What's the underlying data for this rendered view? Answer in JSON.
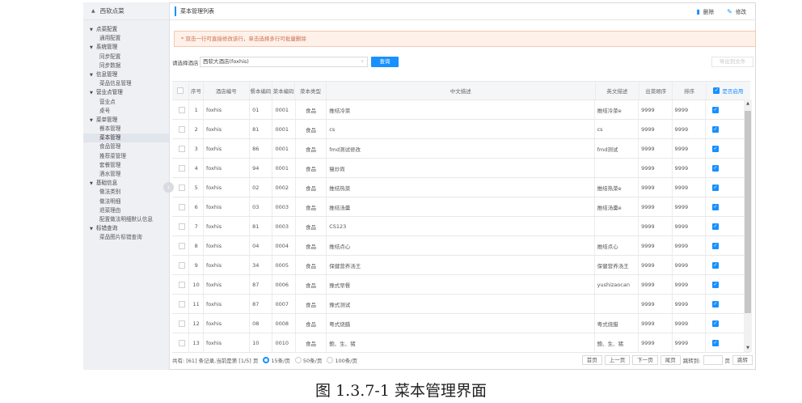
{
  "sidebar": {
    "title": "西软点菜",
    "items": [
      {
        "label": "点菜配置",
        "type": "section"
      },
      {
        "label": "通用配置",
        "type": "item"
      },
      {
        "label": "系统管理",
        "type": "section"
      },
      {
        "label": "同步配置",
        "type": "item"
      },
      {
        "label": "同步数据",
        "type": "item"
      },
      {
        "label": "信息管理",
        "type": "section"
      },
      {
        "label": "菜品信息管理",
        "type": "item"
      },
      {
        "label": "营业点管理",
        "type": "section"
      },
      {
        "label": "营业点",
        "type": "item"
      },
      {
        "label": "桌号",
        "type": "item"
      },
      {
        "label": "菜单管理",
        "type": "section"
      },
      {
        "label": "餐本管理",
        "type": "item"
      },
      {
        "label": "菜本管理",
        "type": "item",
        "active": true
      },
      {
        "label": "食品管理",
        "type": "item"
      },
      {
        "label": "推荐菜管理",
        "type": "item"
      },
      {
        "label": "套餐管理",
        "type": "item"
      },
      {
        "label": "酒水管理",
        "type": "item"
      },
      {
        "label": "基础信息",
        "type": "section"
      },
      {
        "label": "做法类别",
        "type": "item"
      },
      {
        "label": "做法明细",
        "type": "item"
      },
      {
        "label": "退菜理由",
        "type": "item"
      },
      {
        "label": "配置做法明细默认信息",
        "type": "item"
      },
      {
        "label": "标错查询",
        "type": "section"
      },
      {
        "label": "菜品图片标错查询",
        "type": "item"
      }
    ]
  },
  "topbar": {
    "title": "菜本管理列表",
    "delete_label": "删除",
    "edit_label": "修改"
  },
  "hint": "* 双击一行可直接修改该行，单击选择多行可批量删除",
  "filter": {
    "label": "请选择酒店",
    "selected": "西软大酒店(foxhis)",
    "query_label": "查询",
    "export_label": "导出到文件"
  },
  "table": {
    "columns": [
      "序号",
      "酒店编号",
      "餐本编码",
      "菜本编码",
      "菜本类型",
      "中文描述",
      "英文描述",
      "出菜顺序",
      "排序",
      "是否启用"
    ],
    "rows": [
      [
        "1",
        "foxhis",
        "01",
        "0001",
        "食品",
        "推结冷菜",
        "推结冷菜e",
        "9999",
        "9999"
      ],
      [
        "2",
        "foxhis",
        "81",
        "0001",
        "食品",
        "cs",
        "cs",
        "9999",
        "9999"
      ],
      [
        "3",
        "foxhis",
        "86",
        "0001",
        "食品",
        "fmd测试修改",
        "fmd测试",
        "9999",
        "9999"
      ],
      [
        "4",
        "foxhis",
        "94",
        "0001",
        "食品",
        "瘦炒尚",
        "",
        "9999",
        "9999"
      ],
      [
        "5",
        "foxhis",
        "02",
        "0002",
        "食品",
        "推结热菜",
        "推结热菜e",
        "9999",
        "9999"
      ],
      [
        "6",
        "foxhis",
        "03",
        "0003",
        "食品",
        "推结汤羹",
        "推结汤羹e",
        "9999",
        "9999"
      ],
      [
        "7",
        "foxhis",
        "81",
        "0003",
        "食品",
        "CS123",
        "",
        "9999",
        "9999"
      ],
      [
        "8",
        "foxhis",
        "04",
        "0004",
        "食品",
        "推结点心",
        "推结点心",
        "9999",
        "9999"
      ],
      [
        "9",
        "foxhis",
        "34",
        "0005",
        "食品",
        "保健营养汤王",
        "保健营养汤王",
        "9999",
        "9999"
      ],
      [
        "10",
        "foxhis",
        "87",
        "0006",
        "食品",
        "豫式早餐",
        "yushizaocan",
        "9999",
        "9999"
      ],
      [
        "11",
        "foxhis",
        "87",
        "0007",
        "食品",
        "豫式测试",
        "",
        "9999",
        "9999"
      ],
      [
        "12",
        "foxhis",
        "08",
        "0008",
        "食品",
        "粤式烧腊",
        "粤式烧腊",
        "9999",
        "9999"
      ],
      [
        "13",
        "foxhis",
        "10",
        "0010",
        "食品",
        "鲍、生、猪",
        "鲍、生、猪",
        "9999",
        "9999"
      ]
    ]
  },
  "footer": {
    "summary": "共有: [61] 条记录,当前是第 [1/5] 页",
    "opt1": "15条/页",
    "opt2": "50条/页",
    "opt3": "100条/页",
    "first": "首页",
    "prev": "上一页",
    "next": "下一页",
    "last": "尾页",
    "jump_label": "跳转到:",
    "page_unit": "页",
    "jump_btn": "跳转"
  },
  "caption": "图 1.3.7-1 菜本管理界面",
  "colors": {
    "accent": "#1890ff",
    "hint_bg": "#fdf1ea",
    "hint_text": "#d06c4a"
  }
}
